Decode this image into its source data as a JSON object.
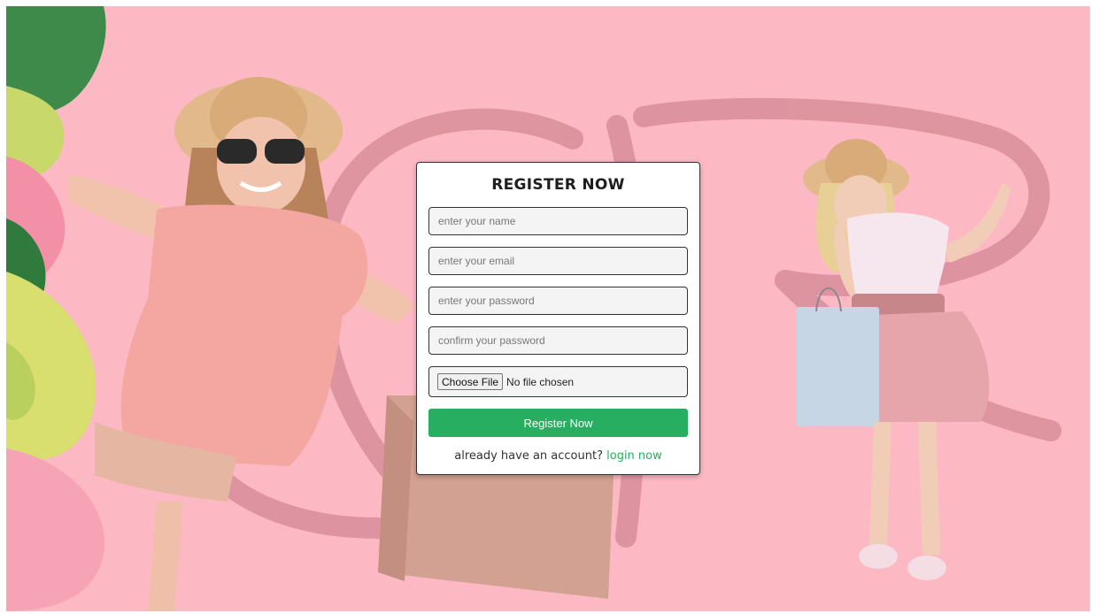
{
  "form": {
    "title": "REGISTER NOW",
    "name_placeholder": "enter your name",
    "email_placeholder": "enter your email",
    "password_placeholder": "enter your password",
    "confirm_placeholder": "confirm your password",
    "file_button_label": "Choose File",
    "file_status": "No file chosen",
    "submit_label": "Register Now",
    "login_prompt": "already have an account?",
    "login_link": "login now"
  },
  "colors": {
    "background": "#fcb9c3",
    "accent": "#27ae60",
    "monogram": "#d98e9a"
  }
}
